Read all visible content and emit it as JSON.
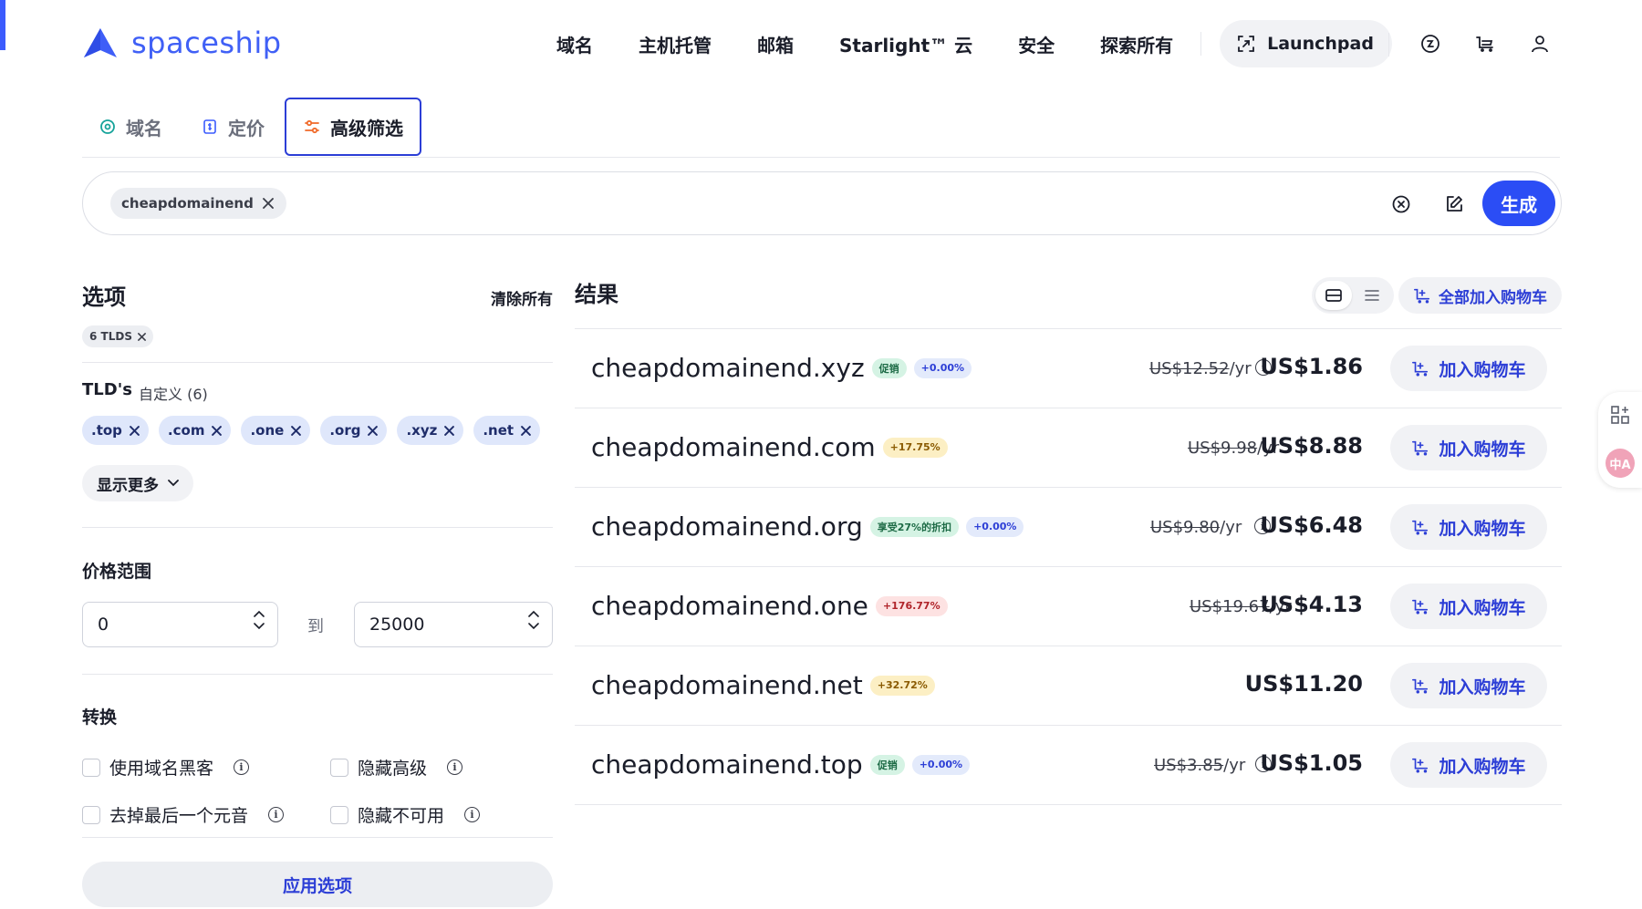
{
  "brand": {
    "name": "spaceship",
    "color": "#4060f6"
  },
  "nav": {
    "items": [
      "域名",
      "主机托管",
      "邮箱",
      "Starlight™ 云",
      "安全",
      "探索所有"
    ],
    "launchpad": "Launchpad",
    "icons": [
      "dollar-circle-icon",
      "cart-icon",
      "user-icon"
    ]
  },
  "tabs": [
    {
      "label": "域名",
      "icon": "target-icon"
    },
    {
      "label": "定价",
      "icon": "price-tag-icon"
    },
    {
      "label": "高级筛选",
      "icon": "sliders-icon",
      "active": true
    }
  ],
  "search": {
    "chip": "cheapdomainend",
    "generate_label": "生成"
  },
  "options": {
    "title": "选项",
    "clear_all": "清除所有",
    "tld_count_chip": "6 TLDS",
    "tlds_label": "TLD's",
    "tlds_custom": "自定义 (6)",
    "tld_chips": [
      ".top",
      ".com",
      ".one",
      ".org",
      ".xyz",
      ".net"
    ],
    "show_more": "显示更多",
    "price_range_title": "价格范围",
    "price_min": "0",
    "price_to": "到",
    "price_max": "25000",
    "transform_title": "转换",
    "checkboxes": [
      "使用域名黑客",
      "隐藏高级",
      "去掉最后一个元音",
      "隐藏不可用"
    ],
    "apply": "应用选项"
  },
  "results": {
    "title": "结果",
    "add_all": "全部加入购物车",
    "add_to_cart": "加入购物车",
    "rows": [
      {
        "domain": "cheapdomainend.xyz",
        "badges": [
          {
            "text": "促销",
            "color": "green"
          },
          {
            "text": "+0.00%",
            "color": "blue"
          }
        ],
        "old_price": "US$12.52",
        "per": "/yr",
        "info": true,
        "price": "US$1.86"
      },
      {
        "domain": "cheapdomainend.com",
        "badges": [
          {
            "text": "+17.75%",
            "color": "yellow"
          }
        ],
        "old_price": "US$9.98",
        "per": "/yr",
        "info": false,
        "price": "US$8.88"
      },
      {
        "domain": "cheapdomainend.org",
        "badges": [
          {
            "text": "享受27%的折扣",
            "color": "green"
          },
          {
            "text": "+0.00%",
            "color": "blue"
          }
        ],
        "old_price": "US$9.80",
        "per": "/yr",
        "info": true,
        "price": "US$6.48"
      },
      {
        "domain": "cheapdomainend.one",
        "badges": [
          {
            "text": "+176.77%",
            "color": "red"
          }
        ],
        "old_price": "US$19.67",
        "per": "/yr",
        "info": false,
        "price": "US$4.13"
      },
      {
        "domain": "cheapdomainend.net",
        "badges": [
          {
            "text": "+32.72%",
            "color": "yellow"
          }
        ],
        "old_price": "",
        "per": "",
        "info": false,
        "price": "US$11.20"
      },
      {
        "domain": "cheapdomainend.top",
        "badges": [
          {
            "text": "促销",
            "color": "green"
          },
          {
            "text": "+0.00%",
            "color": "blue"
          }
        ],
        "old_price": "US$3.85",
        "per": "/yr",
        "info": true,
        "price": "US$1.05"
      }
    ]
  },
  "floating": {
    "translate_label": "中A"
  }
}
